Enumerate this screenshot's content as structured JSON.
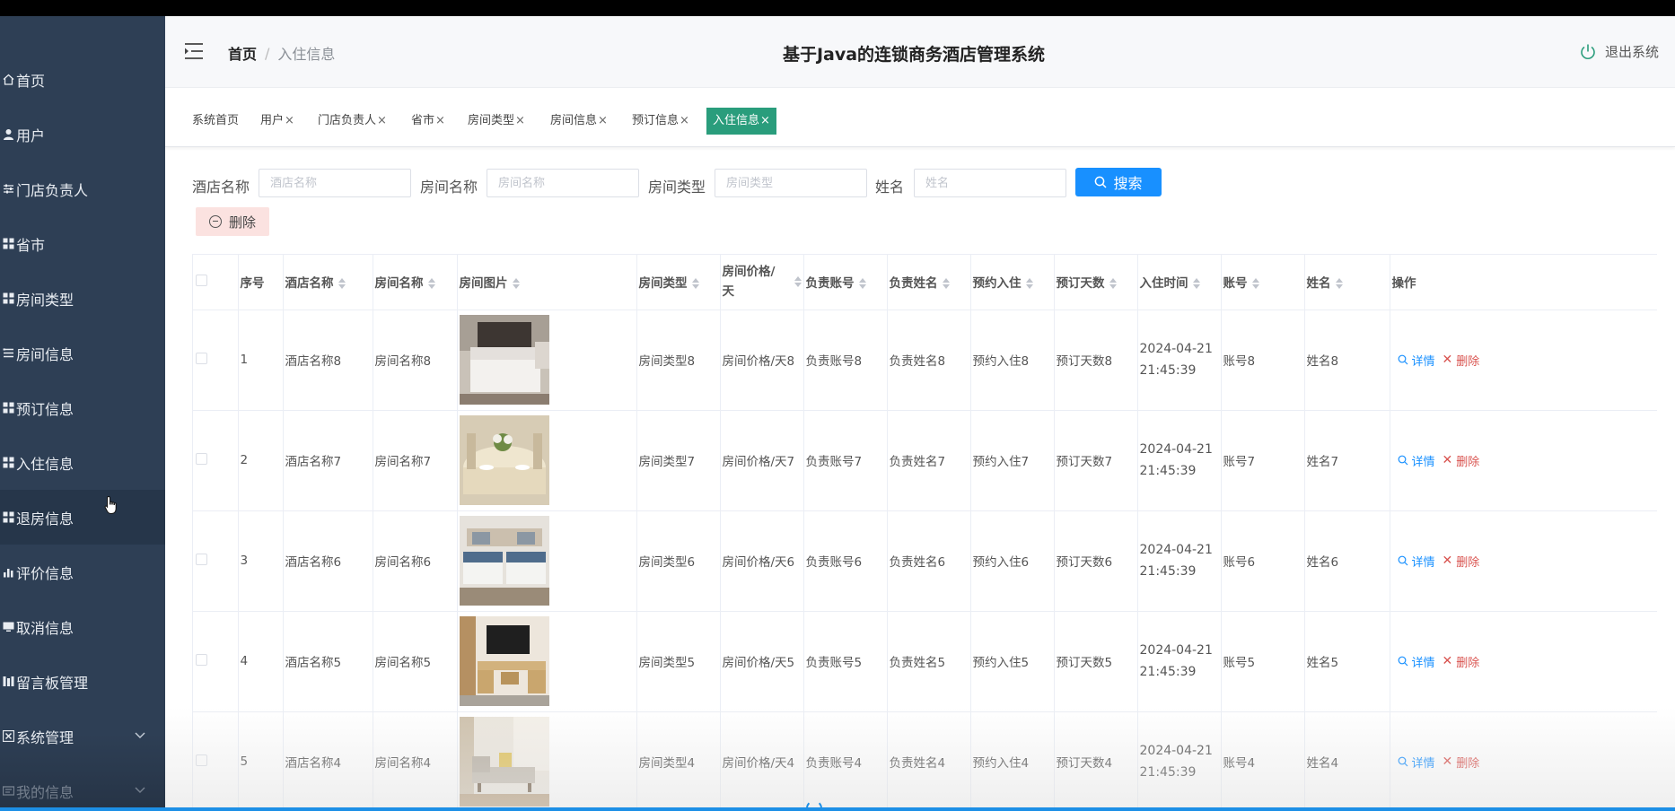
{
  "sidebar": {
    "items": [
      {
        "label": "首页",
        "icon": "home-icon"
      },
      {
        "label": "用户",
        "icon": "user-icon"
      },
      {
        "label": "门店负责人",
        "icon": "sliders-icon"
      },
      {
        "label": "省市",
        "icon": "grid-icon"
      },
      {
        "label": "房间类型",
        "icon": "grid-icon"
      },
      {
        "label": "房间信息",
        "icon": "list-icon"
      },
      {
        "label": "预订信息",
        "icon": "grid-icon"
      },
      {
        "label": "入住信息",
        "icon": "grid-icon"
      },
      {
        "label": "退房信息",
        "icon": "grid-icon"
      },
      {
        "label": "评价信息",
        "icon": "bar-chart-icon"
      },
      {
        "label": "取消信息",
        "icon": "monitor-icon"
      },
      {
        "label": "留言板管理",
        "icon": "board-icon"
      },
      {
        "label": "系统管理",
        "icon": "settings-icon"
      },
      {
        "label": "我的信息",
        "icon": "card-icon"
      }
    ]
  },
  "header": {
    "breadcrumb_home": "首页",
    "breadcrumb_sep": "/",
    "breadcrumb_current": "入住信息",
    "title": "基于Java的连锁商务酒店管理系统",
    "logout": "退出系统"
  },
  "tabs": [
    "系统首页",
    "用户",
    "门店负责人",
    "省市",
    "房间类型",
    "房间信息",
    "预订信息",
    "入住信息"
  ],
  "tab_close": "×",
  "search": {
    "fields": [
      {
        "label": "酒店名称",
        "placeholder": "酒店名称"
      },
      {
        "label": "房间名称",
        "placeholder": "房间名称"
      },
      {
        "label": "房间类型",
        "placeholder": "房间类型"
      },
      {
        "label": "姓名",
        "placeholder": "姓名"
      }
    ],
    "button": "搜索"
  },
  "delete_button": "删除",
  "table": {
    "headers": [
      "序号",
      "酒店名称",
      "房间名称",
      "房间图片",
      "房间类型",
      "房间价格/天",
      "负责账号",
      "负责姓名",
      "预约入住",
      "预订天数",
      "入住时间",
      "账号",
      "姓名",
      "操作"
    ],
    "rows": [
      {
        "no": "1",
        "hotel": "酒店名称8",
        "room": "房间名称8",
        "type": "房间类型8",
        "price": "房间价格/天8",
        "mgr_acct": "负责账号8",
        "mgr_name": "负责姓名8",
        "reserve": "预约入住8",
        "days": "预订天数8",
        "date": "2024-04-21",
        "time": "21:45:39",
        "acct": "账号8",
        "name": "姓名8",
        "photo": "bed"
      },
      {
        "no": "2",
        "hotel": "酒店名称7",
        "room": "房间名称7",
        "type": "房间类型7",
        "price": "房间价格/天7",
        "mgr_acct": "负责账号7",
        "mgr_name": "负责姓名7",
        "reserve": "预约入住7",
        "days": "预订天数7",
        "date": "2024-04-21",
        "time": "21:45:39",
        "acct": "账号7",
        "name": "姓名7",
        "photo": "dining"
      },
      {
        "no": "3",
        "hotel": "酒店名称6",
        "room": "房间名称6",
        "type": "房间类型6",
        "price": "房间价格/天6",
        "mgr_acct": "负责账号6",
        "mgr_name": "负责姓名6",
        "reserve": "预约入住6",
        "days": "预订天数6",
        "date": "2024-04-21",
        "time": "21:45:39",
        "acct": "账号6",
        "name": "姓名6",
        "photo": "twin"
      },
      {
        "no": "4",
        "hotel": "酒店名称5",
        "room": "房间名称5",
        "type": "房间类型5",
        "price": "房间价格/天5",
        "mgr_acct": "负责账号5",
        "mgr_name": "负责姓名5",
        "reserve": "预约入住5",
        "days": "预订天数5",
        "date": "2024-04-21",
        "time": "21:45:39",
        "acct": "账号5",
        "name": "姓名5",
        "photo": "tv"
      },
      {
        "no": "5",
        "hotel": "酒店名称4",
        "room": "房间名称4",
        "type": "房间类型4",
        "price": "房间价格/天4",
        "mgr_acct": "负责账号4",
        "mgr_name": "负责姓名4",
        "reserve": "预约入住4",
        "days": "预订天数4",
        "date": "2024-04-21",
        "time": "21:45:39",
        "acct": "账号4",
        "name": "姓名4",
        "photo": "sofa"
      }
    ],
    "action_detail": "详情",
    "action_delete": "删除"
  },
  "colors": {
    "sidebar_bg": "#2e3f55",
    "active_tab": "#2a9d7c",
    "primary": "#1890ff",
    "danger": "#d9534f"
  }
}
